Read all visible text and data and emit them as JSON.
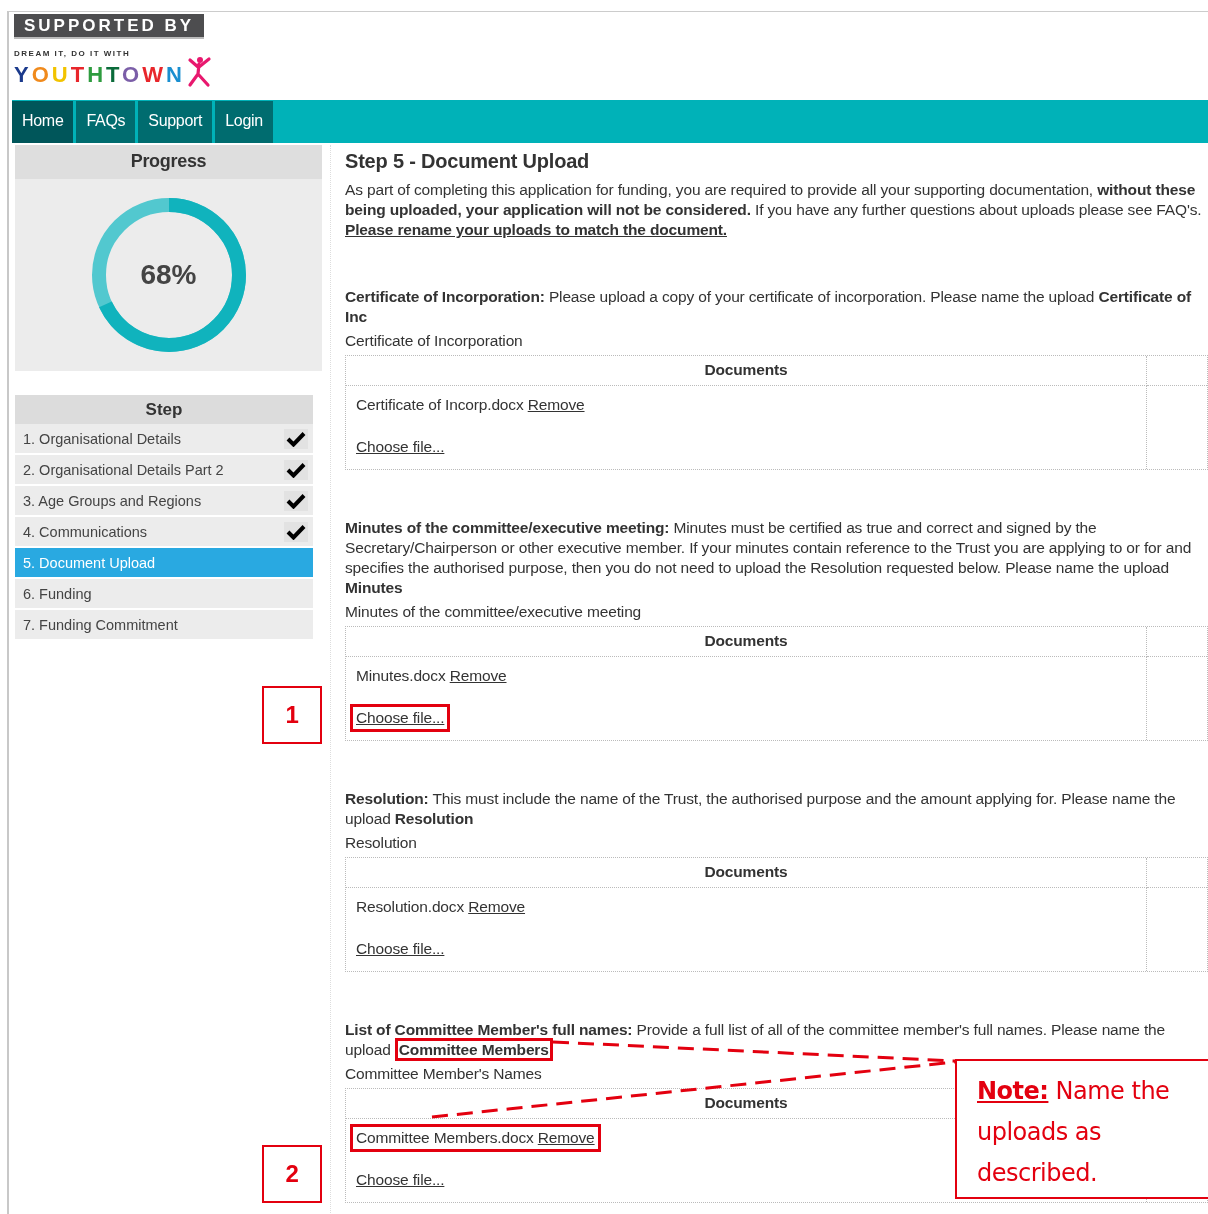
{
  "header": {
    "supported_by": "SUPPORTED BY",
    "tagline": "DREAM IT, DO IT WITH",
    "logo": "YOUTHTOWN"
  },
  "nav": [
    {
      "label": "Home",
      "selected": true
    },
    {
      "label": "FAQs",
      "selected": false
    },
    {
      "label": "Support",
      "selected": false
    },
    {
      "label": "Login",
      "selected": false
    }
  ],
  "progress": {
    "title": "Progress",
    "percent": "68%",
    "level": 0.68
  },
  "steps": {
    "title": "Step",
    "items": [
      {
        "number": "1.",
        "label": "Organisational Details",
        "done": true,
        "selected": false
      },
      {
        "number": "2.",
        "label": "Organisational Details Part 2",
        "done": true,
        "selected": false
      },
      {
        "number": "3.",
        "label": "Age Groups and Regions",
        "done": true,
        "selected": false
      },
      {
        "number": "4.",
        "label": "Communications",
        "done": true,
        "selected": false
      },
      {
        "number": "5.",
        "label": "Document Upload",
        "done": false,
        "selected": true
      },
      {
        "number": "6.",
        "label": "Funding",
        "done": false,
        "selected": false
      },
      {
        "number": "7.",
        "label": "Funding Commitment",
        "done": false,
        "selected": false
      }
    ]
  },
  "page": {
    "title": "Step 5 - Document Upload",
    "intro": "As part of completing this application for funding, you are required to provide all your supporting documentation, **without these being uploaded, your application will not be considered.** If you have any further questions about uploads please see FAQ's.",
    "intro_link": "Please rename your uploads to match the document."
  },
  "sections": [
    {
      "description": "**Certificate of Incorporation:** Please upload a copy of your certificate of incorporation. Please name the upload **Certificate of Inc**",
      "label": "Certificate of Incorporation",
      "column": "Documents",
      "file": "Certificate of Incorp.docx",
      "remove": "Remove",
      "choose": "Choose file..."
    },
    {
      "description": "**Minutes of the committee/executive meeting:** Minutes must be certified as true and correct and signed by the Secretary/Chairperson or other executive member. If your minutes contain reference to the Trust you are applying to or for and specifies the authorised purpose, then you do not need to upload the Resolution requested below. Please name the upload **Minutes**",
      "label": "Minutes of the committee/executive meeting",
      "column": "Documents",
      "file": "Minutes.docx",
      "remove": "Remove",
      "choose": "Choose file...",
      "marker": "1",
      "choose_highlighted": true
    },
    {
      "description": "**Resolution:** This must include the name of the Trust, the authorised purpose and the amount applying for. Please name the upload **Resolution**",
      "label": "Resolution",
      "column": "Documents",
      "file": "Resolution.docx",
      "remove": "Remove",
      "choose": "Choose file..."
    },
    {
      "description": "**List of Committee Member's full names:** Provide a full list of all of the committee member's full names. Please name the upload **Committee Members**",
      "label": "Committee Member's Names",
      "column": "Documents",
      "file": "Committee Members.docx",
      "remove": "Remove",
      "choose": "Choose file...",
      "marker": "2",
      "file_highlighted": true,
      "emphasis_highlighted": true
    }
  ],
  "note": {
    "title": "Note:",
    "text": "Name the uploads as described."
  }
}
